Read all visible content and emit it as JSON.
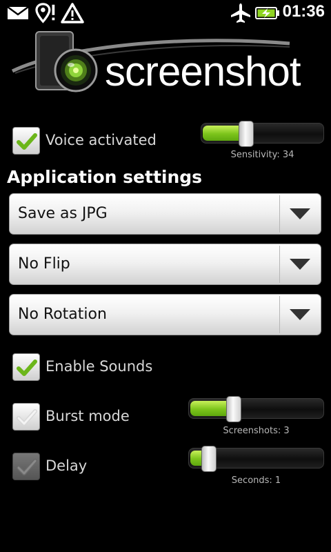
{
  "status_bar": {
    "time": "01:36",
    "icons": [
      "mail-icon",
      "location-alert-icon",
      "warning-icon",
      "airplane-mode-icon",
      "battery-charging-icon"
    ]
  },
  "header": {
    "logo_text": "screenshot",
    "icon": "camera-icon"
  },
  "voice": {
    "label": "Voice activated",
    "checked": true,
    "sensitivity_caption": "Sensitivity: 34",
    "sensitivity": 34
  },
  "app_settings": {
    "title": "Application settings",
    "spinners": [
      {
        "value": "Save as JPG"
      },
      {
        "value": "No Flip"
      },
      {
        "value": "No Rotation"
      }
    ]
  },
  "enable_sounds": {
    "label": "Enable Sounds",
    "checked": true
  },
  "burst_mode": {
    "label": "Burst mode",
    "checked": false,
    "caption": "Screenshots: 3",
    "value": 3
  },
  "delay": {
    "label": "Delay",
    "checked": false,
    "enabled": false,
    "caption": "Seconds: 1",
    "value": 1
  },
  "colors": {
    "accent_green": "#7cc41c",
    "background": "#000000"
  }
}
